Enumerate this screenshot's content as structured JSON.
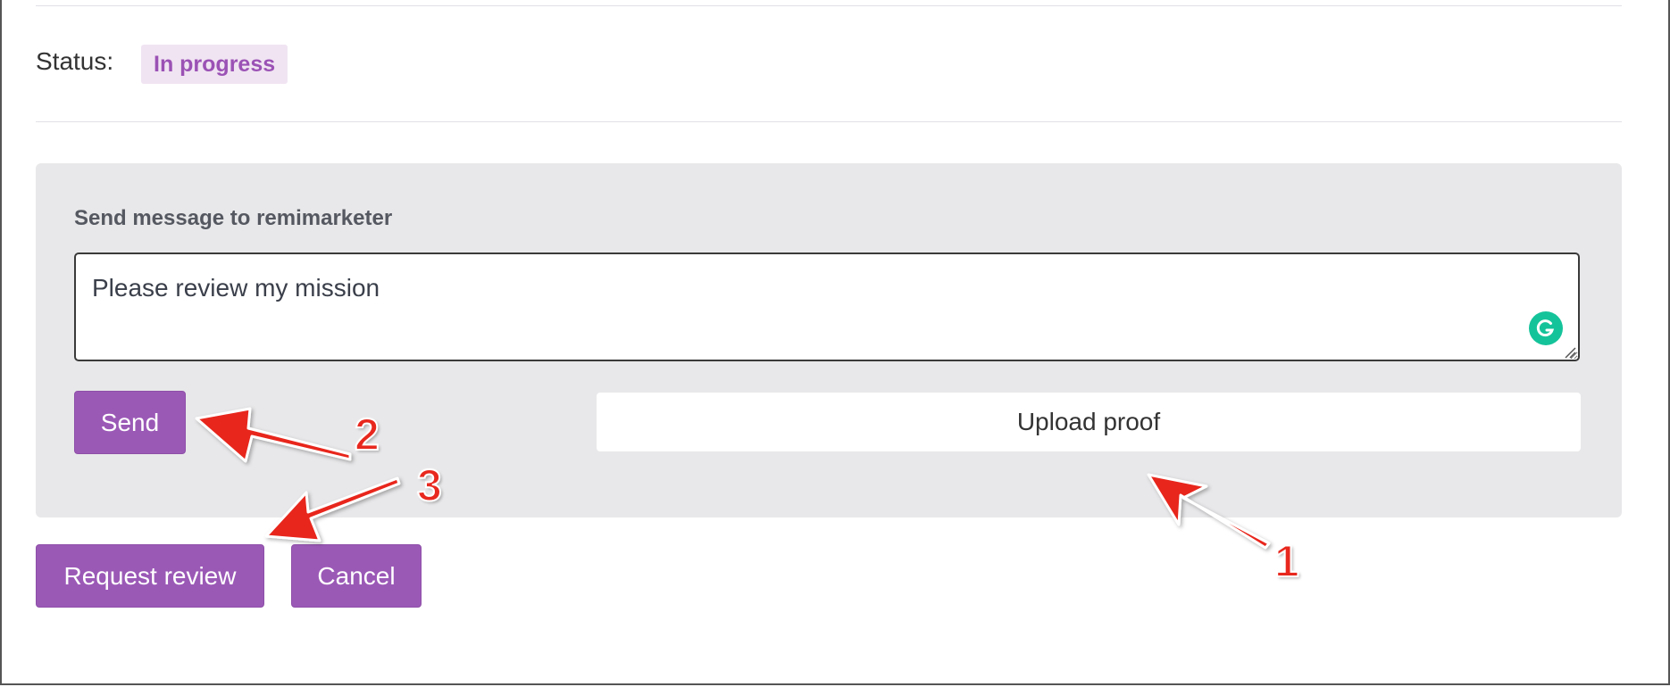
{
  "status": {
    "label": "Status:",
    "value": "In progress"
  },
  "message_panel": {
    "title": "Send message to remimarketer",
    "message_text": "Please review my mission",
    "send_label": "Send",
    "upload_label": "Upload proof"
  },
  "actions": {
    "request_review_label": "Request review",
    "cancel_label": "Cancel"
  },
  "annotations": {
    "numbers": [
      "1",
      "2",
      "3"
    ],
    "color": "#e8281e"
  },
  "colors": {
    "accent": "#9b59b6",
    "badge_background": "#f0e4f2",
    "badge_text": "#9b52b5",
    "panel_background": "#e8e8ea",
    "grammarly": "#15c39a"
  },
  "icons": [
    "grammarly-icon",
    "resize-handle-icon"
  ]
}
